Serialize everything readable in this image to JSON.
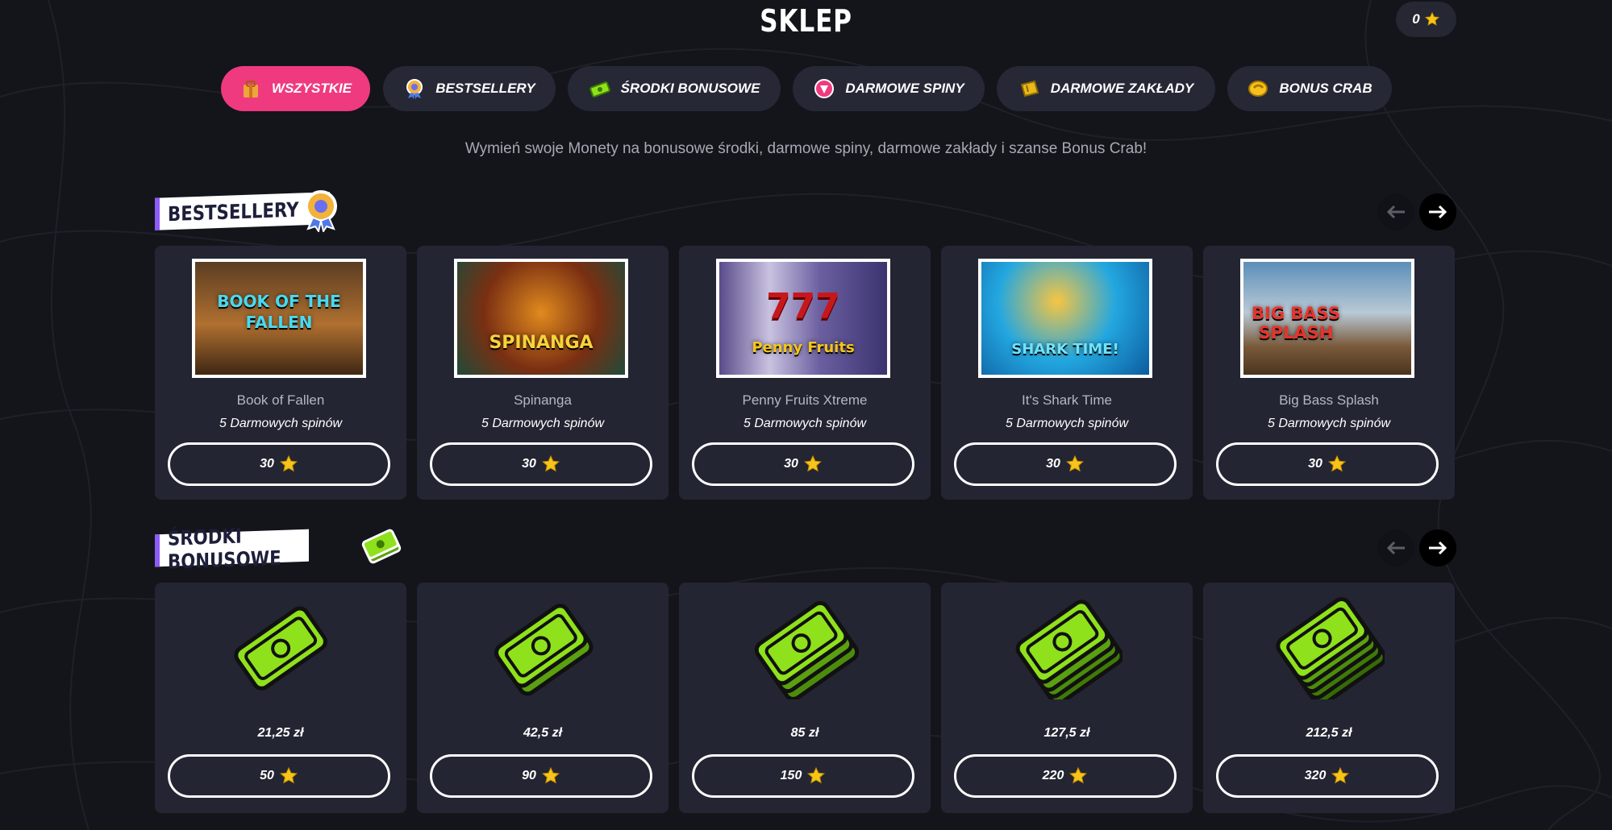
{
  "title": "SKLEP",
  "balance": {
    "value": "0",
    "icon": "star-icon"
  },
  "tabs": [
    {
      "label": "WSZYSTKIE",
      "icon": "gift-bag-icon",
      "active": true
    },
    {
      "label": "BESTSELLERY",
      "icon": "medal-icon",
      "active": false
    },
    {
      "label": "ŚRODKI BONUSOWE",
      "icon": "money-icon",
      "active": false
    },
    {
      "label": "DARMOWE SPINY",
      "icon": "slot-spin-icon",
      "active": false
    },
    {
      "label": "DARMOWE ZAKŁADY",
      "icon": "ticket-icon",
      "active": false
    },
    {
      "label": "BONUS CRAB",
      "icon": "crab-claw-icon",
      "active": false
    }
  ],
  "subtitle": "Wymień swoje Monety na bonusowe środki, darmowe spiny, darmowe zakłady i szanse Bonus Crab!",
  "bestsellers": {
    "heading": "BESTSELLERY",
    "items": [
      {
        "thumb_text": "BOOK OF THE FALLEN",
        "name": "Book of Fallen",
        "desc": "5 Darmowych spinów",
        "price": "30"
      },
      {
        "thumb_text": "SPINANGA",
        "name": "Spinanga",
        "desc": "5 Darmowych spinów",
        "price": "30"
      },
      {
        "thumb_text": "777 Penny Fruits",
        "name": "Penny Fruits Xtreme",
        "desc": "5 Darmowych spinów",
        "price": "30"
      },
      {
        "thumb_text": "SHARK TIME!",
        "name": "It's Shark Time",
        "desc": "5 Darmowych spinów",
        "price": "30"
      },
      {
        "thumb_text": "BIG BASS SPLASH",
        "name": "Big Bass Splash",
        "desc": "5 Darmowych spinów",
        "price": "30"
      }
    ]
  },
  "bonus_funds": {
    "heading": "ŚRODKI BONUSOWE",
    "items": [
      {
        "amount": "21,25 zł",
        "price": "50",
        "stack": 1
      },
      {
        "amount": "42,5 zł",
        "price": "90",
        "stack": 2
      },
      {
        "amount": "85 zł",
        "price": "150",
        "stack": 3
      },
      {
        "amount": "127,5 zł",
        "price": "220",
        "stack": 4
      },
      {
        "amount": "212,5 zł",
        "price": "320",
        "stack": 5
      }
    ]
  },
  "colors": {
    "background": "#14151b",
    "card": "#232532",
    "tab": "#262836",
    "tab_active": "#ef3a7f",
    "money_green": "#8fe11b",
    "star": "#f5c518"
  }
}
